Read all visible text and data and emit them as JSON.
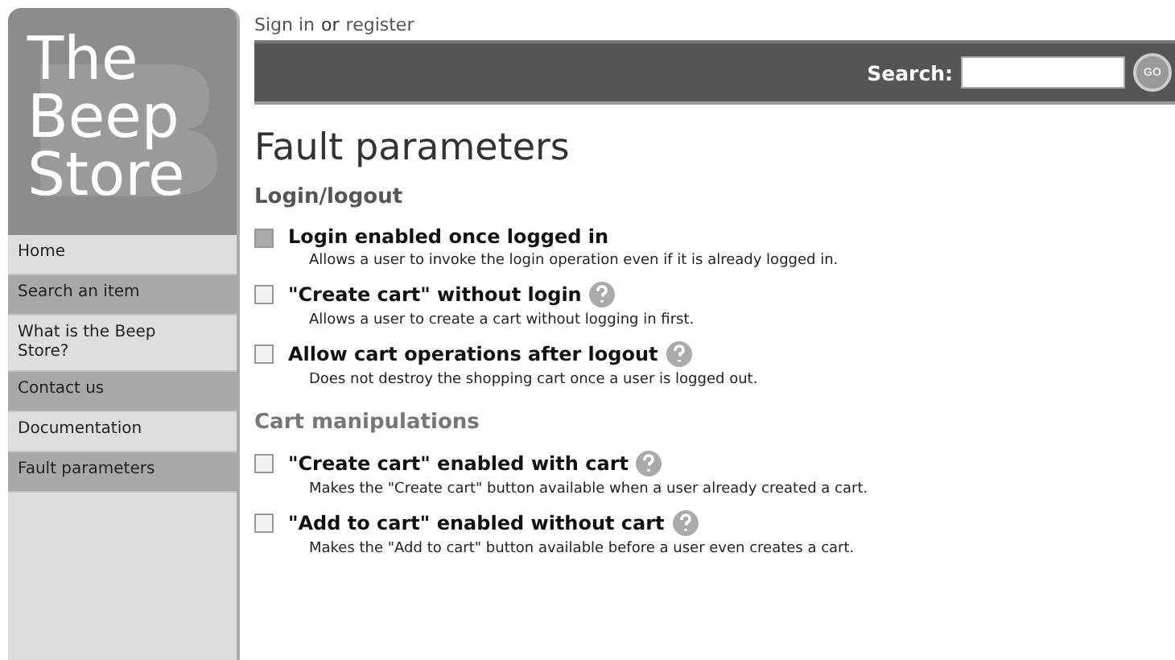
{
  "logo": {
    "lines": [
      "The",
      "Beep",
      "Store"
    ]
  },
  "sidebar": {
    "items": [
      {
        "label": "Home"
      },
      {
        "label": "Search an item"
      },
      {
        "label": "What is the Beep Store?"
      },
      {
        "label": "Contact us"
      },
      {
        "label": "Documentation"
      },
      {
        "label": "Fault parameters"
      }
    ]
  },
  "account": {
    "sign_in": "Sign in",
    "separator": "or",
    "register": "register"
  },
  "search": {
    "label": "Search:",
    "button": "GO"
  },
  "title": "Fault parameters",
  "sections": [
    {
      "heading": "Login/logout",
      "options": [
        {
          "label": "Login enabled once logged in",
          "description": "Allows a user to invoke the login operation even if it is already logged in.",
          "checked": true,
          "help": false
        },
        {
          "label": "\"Create cart\" without login",
          "description": "Allows a user to create a cart without logging in first.",
          "checked": false,
          "help": true
        },
        {
          "label": "Allow cart operations after logout",
          "description": "Does not destroy the shopping cart once a user is logged out.",
          "checked": false,
          "help": true
        }
      ]
    },
    {
      "heading": "Cart manipulations",
      "options": [
        {
          "label": "\"Create cart\" enabled with cart",
          "description": "Makes the \"Create cart\" button available when a user already created a cart.",
          "checked": false,
          "help": true
        },
        {
          "label": "\"Add to cart\" enabled without cart",
          "description": "Makes the \"Add to cart\" button available before a user even creates a cart.",
          "checked": false,
          "help": true
        }
      ]
    }
  ]
}
